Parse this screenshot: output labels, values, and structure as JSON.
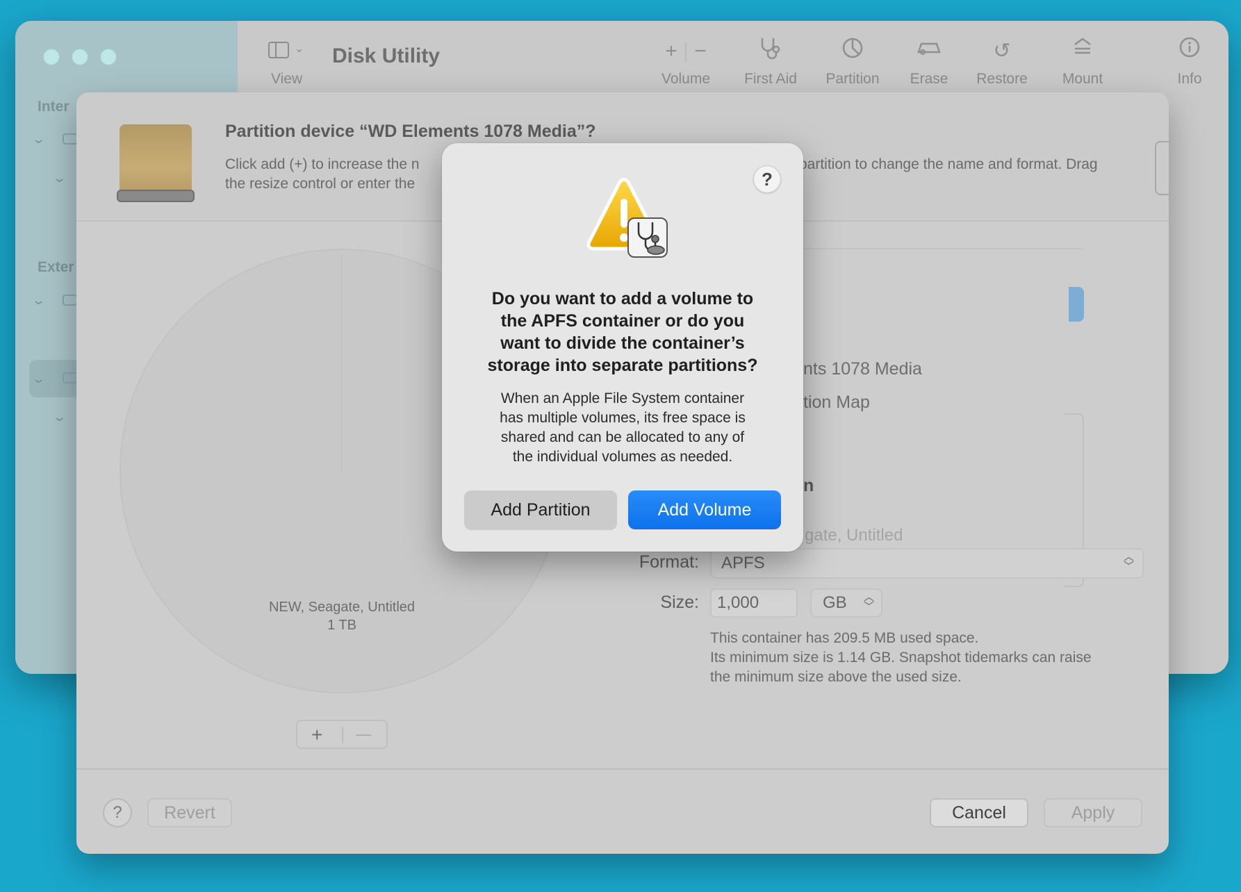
{
  "window": {
    "app_title": "Disk Utility",
    "sidebar": {
      "section_internal": "Inter",
      "section_external": "Exter"
    },
    "toolbar": {
      "view_label": "View",
      "volume_label": "Volume",
      "first_aid_label": "First Aid",
      "partition_label": "Partition",
      "erase_label": "Erase",
      "restore_label": "Restore",
      "mount_label": "Mount",
      "info_label": "Info"
    }
  },
  "sheet": {
    "title": "Partition device “WD Elements 1078 Media”?",
    "desc_line1_left": "Click add (+) to increase the n",
    "desc_line1_right": "partition to change the name and format. Drag",
    "desc_line2_left": "the resize control or enter the",
    "pie_label_name": "NEW, Seagate, Untitled",
    "pie_label_size": "1 TB",
    "plus_symbol": "+",
    "minus_symbol": "—",
    "device_name_partial": "nts 1078 Media",
    "scheme_partial": "tion Map",
    "section_partial": "n",
    "name_placeholder_partial": "gate, Untitled",
    "format_label": "Format:",
    "format_value": "APFS",
    "size_label": "Size:",
    "size_value": "1,000",
    "size_unit": "GB",
    "size_note_1": "This container has 209.5 MB used space.",
    "size_note_2": "Its minimum size is 1.14 GB. Snapshot tidemarks can raise",
    "size_note_3": "the minimum size above the used size.",
    "help_symbol": "?",
    "revert_label": "Revert",
    "cancel_label": "Cancel",
    "apply_label": "Apply"
  },
  "alert": {
    "help_symbol": "?",
    "title_line1": "Do you want to add a volume to",
    "title_line2": "the APFS container or do you",
    "title_line3": "want to divide the container’s",
    "title_line4": "storage into separate partitions?",
    "body_line1": "When an Apple File System container",
    "body_line2": "has multiple volumes, its free space is",
    "body_line3": "shared and can be allocated to any of",
    "body_line4": "the individual volumes as needed.",
    "secondary_button": "Add Partition",
    "primary_button": "Add Volume"
  },
  "icons": {
    "alert_icon": "warning-triangle-with-first-aid-icon",
    "drive_icon": "external-drive-icon"
  },
  "colors": {
    "desktop": "#1aa7cc",
    "primary_button": "#1479f0",
    "warning_yellow": "#f1b500"
  }
}
